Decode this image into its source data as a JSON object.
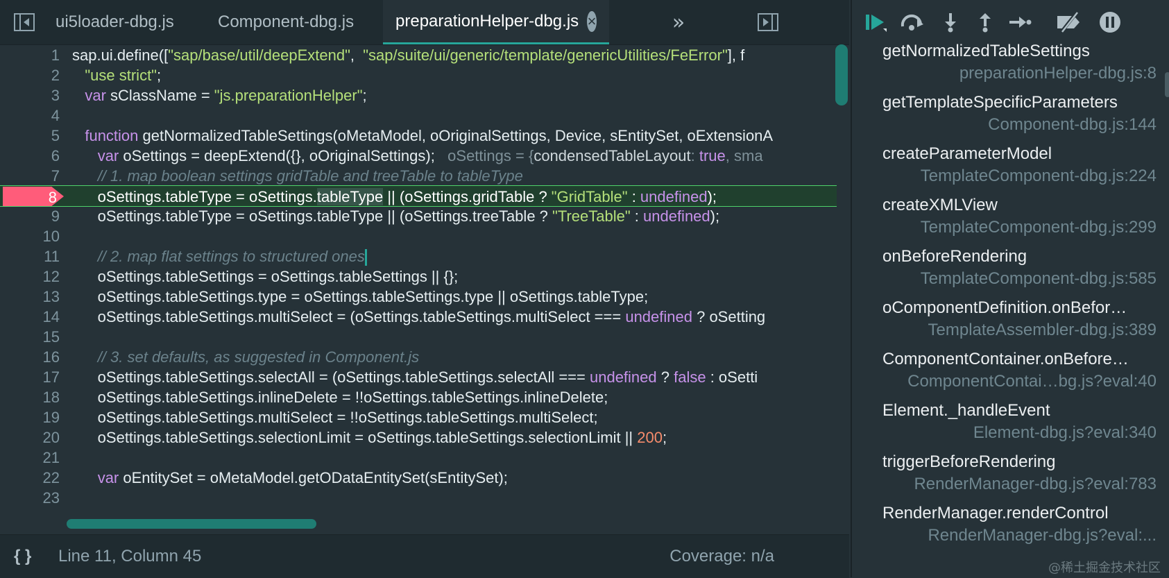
{
  "tabs": [
    {
      "label": "ui5loader-dbg.js"
    },
    {
      "label": "Component-dbg.js"
    },
    {
      "label": "preparationHelper-dbg.js",
      "active": true
    }
  ],
  "icons": {
    "sidebar_toggle": "sidebar-toggle-icon",
    "overflow": "»",
    "close": "×",
    "pretty_print": "{ }"
  },
  "code_lines": [
    {
      "n": "1",
      "segments": [
        {
          "t": "sap.ui.define(["
        },
        {
          "t": "\"sap/base/util/deepExtend\"",
          "c": "t-str"
        },
        {
          "t": ",  "
        },
        {
          "t": "\"sap/suite/ui/generic/template/genericUtilities/FeError\"",
          "c": "t-str"
        },
        {
          "t": "], f"
        }
      ]
    },
    {
      "n": "2",
      "segments": [
        {
          "t": "   "
        },
        {
          "t": "\"use strict\"",
          "c": "t-str"
        },
        {
          "t": ";"
        }
      ]
    },
    {
      "n": "3",
      "segments": [
        {
          "t": "   "
        },
        {
          "t": "var",
          "c": "t-kw"
        },
        {
          "t": " sClassName = "
        },
        {
          "t": "\"js.preparationHelper\"",
          "c": "t-str"
        },
        {
          "t": ";"
        }
      ]
    },
    {
      "n": "4",
      "segments": []
    },
    {
      "n": "5",
      "segments": [
        {
          "t": "   "
        },
        {
          "t": "function",
          "c": "t-kw"
        },
        {
          "t": " getNormalizedTableSettings(oMetaModel, oOriginalSettings, Device, sEntitySet, oExtensionA"
        }
      ]
    },
    {
      "n": "6",
      "segments": [
        {
          "t": "      "
        },
        {
          "t": "var",
          "c": "t-kw"
        },
        {
          "t": " oSettings = deepExtend({}, oOriginalSettings);   "
        },
        {
          "t": "oSettings = {",
          "c": "t-inline"
        },
        {
          "t": "condensedTableLayout",
          "c": "t-inline-val"
        },
        {
          "t": ": ",
          "c": "t-inline"
        },
        {
          "t": "true",
          "c": "t-kw"
        },
        {
          "t": ", sma",
          "c": "t-inline"
        }
      ]
    },
    {
      "n": "7",
      "segments": [
        {
          "t": "      "
        },
        {
          "t": "// 1. map boolean settings gridTable and treeTable to tableType",
          "c": "t-com"
        }
      ]
    },
    {
      "n": "8",
      "current": true,
      "segments": [
        {
          "t": "      oSettings.tableType = oSettings."
        },
        {
          "t": "tableType",
          "c": "t-hl"
        },
        {
          "t": " || (oSettings.gridTable ? "
        },
        {
          "t": "\"GridTable\"",
          "c": "t-str"
        },
        {
          "t": " : "
        },
        {
          "t": "undefined",
          "c": "t-kw"
        },
        {
          "t": ");"
        }
      ]
    },
    {
      "n": "9",
      "segments": [
        {
          "t": "      oSettings.tableType = oSettings.tableType || (oSettings.treeTable ? "
        },
        {
          "t": "\"TreeTable\"",
          "c": "t-str"
        },
        {
          "t": " : "
        },
        {
          "t": "undefined",
          "c": "t-kw"
        },
        {
          "t": ");"
        }
      ]
    },
    {
      "n": "10",
      "segments": []
    },
    {
      "n": "11",
      "caret": true,
      "segments": [
        {
          "t": "      "
        },
        {
          "t": "// 2. map flat settings to structured ones",
          "c": "t-com"
        }
      ]
    },
    {
      "n": "12",
      "segments": [
        {
          "t": "      oSettings.tableSettings = oSettings.tableSettings || {};"
        }
      ]
    },
    {
      "n": "13",
      "segments": [
        {
          "t": "      oSettings.tableSettings.type = oSettings.tableSettings.type || oSettings.tableType;"
        }
      ]
    },
    {
      "n": "14",
      "segments": [
        {
          "t": "      oSettings.tableSettings.multiSelect = (oSettings.tableSettings.multiSelect === "
        },
        {
          "t": "undefined",
          "c": "t-kw"
        },
        {
          "t": " ? oSetting"
        }
      ]
    },
    {
      "n": "15",
      "segments": []
    },
    {
      "n": "16",
      "segments": [
        {
          "t": "      "
        },
        {
          "t": "// 3. set defaults, as suggested in Component.js",
          "c": "t-com"
        }
      ]
    },
    {
      "n": "17",
      "segments": [
        {
          "t": "      oSettings.tableSettings.selectAll = (oSettings.tableSettings.selectAll === "
        },
        {
          "t": "undefined",
          "c": "t-kw"
        },
        {
          "t": " ? "
        },
        {
          "t": "false",
          "c": "t-kw"
        },
        {
          "t": " : oSetti"
        }
      ]
    },
    {
      "n": "18",
      "segments": [
        {
          "t": "      oSettings.tableSettings.inlineDelete = !!oSettings.tableSettings.inlineDelete;"
        }
      ]
    },
    {
      "n": "19",
      "segments": [
        {
          "t": "      oSettings.tableSettings.multiSelect = !!oSettings.tableSettings.multiSelect;"
        }
      ]
    },
    {
      "n": "20",
      "segments": [
        {
          "t": "      oSettings.tableSettings.selectionLimit = oSettings.tableSettings.selectionLimit || "
        },
        {
          "t": "200",
          "c": "t-num"
        },
        {
          "t": ";"
        }
      ]
    },
    {
      "n": "21",
      "segments": []
    },
    {
      "n": "22",
      "segments": [
        {
          "t": "      "
        },
        {
          "t": "var",
          "c": "t-kw"
        },
        {
          "t": " oEntitySet = oMetaModel.getODataEntitySet(sEntitySet);"
        }
      ]
    },
    {
      "n": "23",
      "segments": []
    }
  ],
  "status": {
    "position": "Line 11, Column 45",
    "coverage": "Coverage: n/a"
  },
  "call_stack": [
    {
      "fn": "getNormalizedTableSettings",
      "loc": "preparationHelper-dbg.js:8"
    },
    {
      "fn": "getTemplateSpecificParameters",
      "loc": "Component-dbg.js:144"
    },
    {
      "fn": "createParameterModel",
      "loc": "TemplateComponent-dbg.js:224"
    },
    {
      "fn": "createXMLView",
      "loc": "TemplateComponent-dbg.js:299"
    },
    {
      "fn": "onBeforeRendering",
      "loc": "TemplateComponent-dbg.js:585"
    },
    {
      "fn": "oComponentDefinition.onBefor…",
      "loc": "TemplateAssembler-dbg.js:389"
    },
    {
      "fn": "ComponentContainer.onBefore…",
      "loc": "ComponentContai…bg.js?eval:40"
    },
    {
      "fn": "Element._handleEvent",
      "loc": "Element-dbg.js?eval:340"
    },
    {
      "fn": "triggerBeforeRendering",
      "loc": "RenderManager-dbg.js?eval:783"
    },
    {
      "fn": "RenderManager.renderControl",
      "loc": "RenderManager-dbg.js?eval:..."
    }
  ],
  "watermark": "@稀土掘金技术社区",
  "colors": {
    "accent": "#26a69a",
    "breakpoint": "#ff5c7a",
    "current_line": "#4fd36a"
  }
}
